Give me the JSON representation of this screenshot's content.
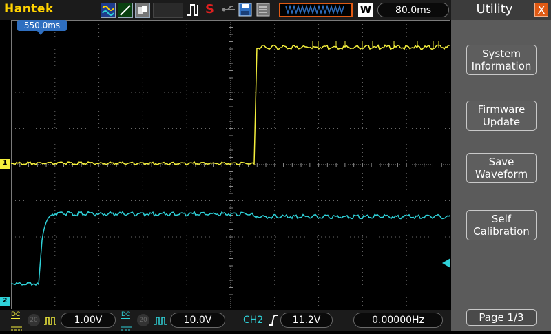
{
  "brand": "Hantek",
  "timebase": "80.0ms",
  "window_mode": "W",
  "trigger_position": "550.0ms",
  "colors": {
    "ch1": "#f4ef3c",
    "ch2": "#2fd1d8",
    "accent": "#e05a14"
  },
  "icons": {
    "wave_mode": "waveform-mode-icon",
    "line_mode": "line-mode-icon",
    "persist": "persist-icon",
    "trigger_edge": "trigger-edge-icon",
    "stop": "stop-icon",
    "save": "save-icon",
    "usb": "usb-icon"
  },
  "panel": {
    "title": "Utility",
    "close": "X",
    "buttons": [
      {
        "line1": "System",
        "line2": "Information"
      },
      {
        "line1": "Firmware",
        "line2": "Update"
      },
      {
        "line1": "Save",
        "line2": "Waveform"
      },
      {
        "line1": "Self",
        "line2": "Calibration"
      }
    ],
    "page": "Page 1/3"
  },
  "bottom": {
    "ch1_coupling": "DC",
    "ch1_scale": "1.00V",
    "ch2_coupling": "DC",
    "ch2_scale": "10.0V",
    "trigger_source": "CH2",
    "trigger_level": "11.2V",
    "frequency": "0.00000Hz"
  },
  "markers": {
    "ch1": "1",
    "ch2": "2"
  }
}
